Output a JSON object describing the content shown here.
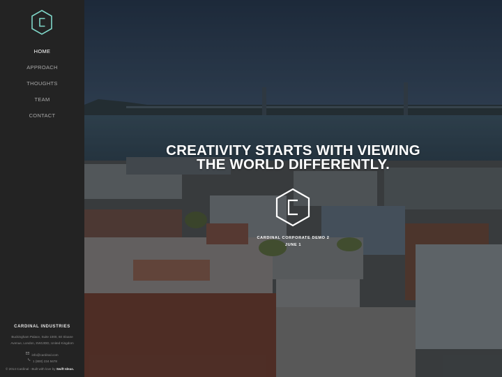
{
  "sidebar": {
    "logo_icon": "cardinal-hexagon-logo-icon",
    "accent_color": "#7fd6c8",
    "nav": [
      {
        "label": "HOME",
        "active": true
      },
      {
        "label": "APPROACH",
        "active": false
      },
      {
        "label": "THOUGHTS",
        "active": false
      },
      {
        "label": "TEAM",
        "active": false
      },
      {
        "label": "CONTACT",
        "active": false
      }
    ],
    "footer": {
      "company": "CARDINAL INDUSTRIES",
      "address_line1": "Buckingham Palace, Suite 1000, 60 Sloane",
      "address_line2": "Avenue, London, SW13DD, United Kingdom",
      "email": "info@cardinal.com",
      "phone": "1 (800) 234 5678",
      "copyright_prefix": "© 2014 Cardinal - Built with love by ",
      "copyright_brand": "Swift Ideas."
    }
  },
  "hero": {
    "headline_line1": "CREATIVITY STARTS WITH VIEWING",
    "headline_line2": "THE WORLD DIFFERENTLY.",
    "logo_icon": "cardinal-hexagon-logo-icon",
    "tagline1": "CARDINAL CORPORATE DEMO 2",
    "tagline2": "JUNE 1"
  }
}
